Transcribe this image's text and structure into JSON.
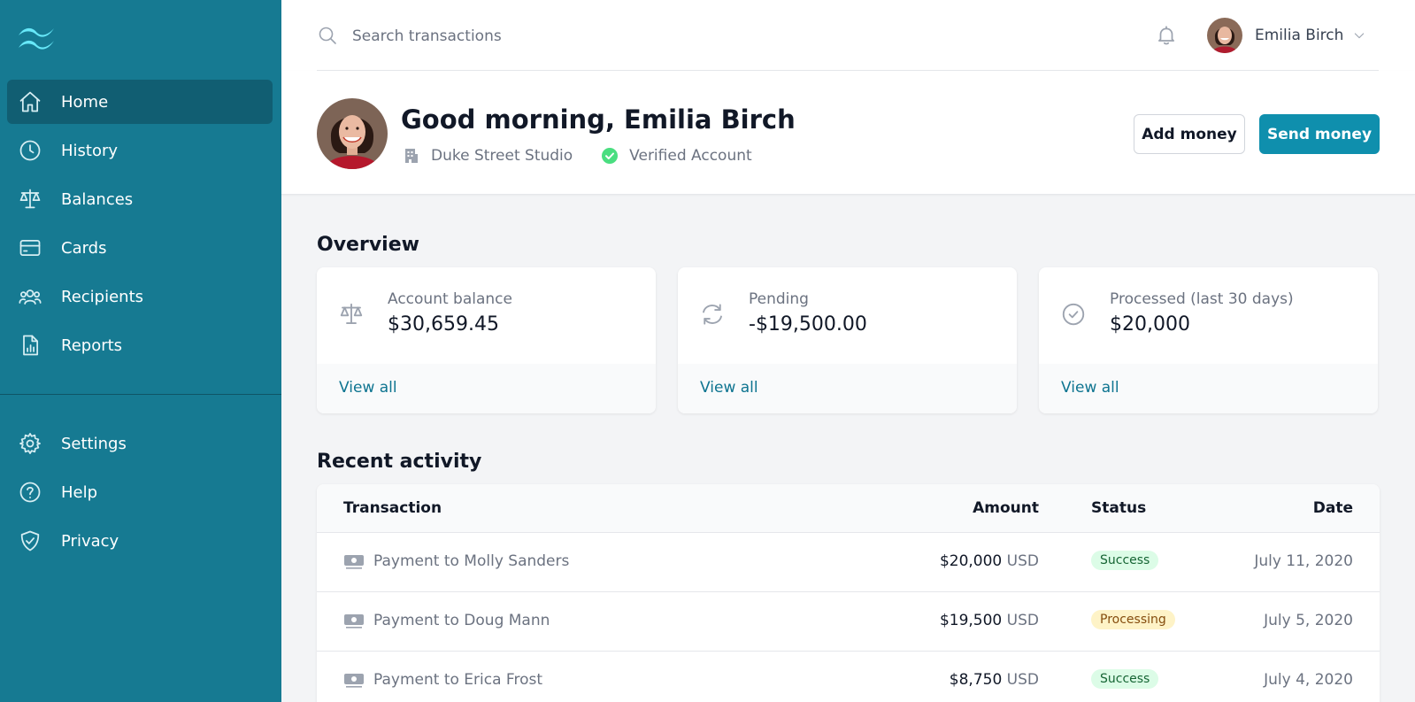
{
  "sidebar": {
    "primary": [
      {
        "label": "Home",
        "icon": "home-icon",
        "active": true
      },
      {
        "label": "History",
        "icon": "clock-icon"
      },
      {
        "label": "Balances",
        "icon": "scale-icon"
      },
      {
        "label": "Cards",
        "icon": "credit-card-icon"
      },
      {
        "label": "Recipients",
        "icon": "user-group-icon"
      },
      {
        "label": "Reports",
        "icon": "document-report-icon"
      }
    ],
    "secondary": [
      {
        "label": "Settings",
        "icon": "cog-icon"
      },
      {
        "label": "Help",
        "icon": "question-circle-icon"
      },
      {
        "label": "Privacy",
        "icon": "shield-check-icon"
      }
    ]
  },
  "topbar": {
    "search_placeholder": "Search transactions",
    "user_name": "Emilia Birch"
  },
  "header": {
    "greeting": "Good morning, Emilia Birch",
    "company": "Duke Street Studio",
    "verification": "Verified Account",
    "add_money": "Add money",
    "send_money": "Send money"
  },
  "overview": {
    "title": "Overview",
    "cards": [
      {
        "label": "Account balance",
        "value": "$30,659.45",
        "link": "View all",
        "icon": "scale-icon"
      },
      {
        "label": "Pending",
        "value": "-$19,500.00",
        "link": "View all",
        "icon": "refresh-icon"
      },
      {
        "label": "Processed (last 30 days)",
        "value": "$20,000",
        "link": "View all",
        "icon": "check-circle-icon"
      }
    ]
  },
  "activity": {
    "title": "Recent activity",
    "columns": {
      "transaction": "Transaction",
      "amount": "Amount",
      "status": "Status",
      "date": "Date"
    },
    "rows": [
      {
        "name": "Payment to Molly Sanders",
        "amount": "$20,000",
        "currency": "USD",
        "status": "Success",
        "date": "July 11, 2020"
      },
      {
        "name": "Payment to Doug Mann",
        "amount": "$19,500",
        "currency": "USD",
        "status": "Processing",
        "date": "July 5, 2020"
      },
      {
        "name": "Payment to Erica Frost",
        "amount": "$8,750",
        "currency": "USD",
        "status": "Success",
        "date": "July 4, 2020"
      }
    ]
  },
  "colors": {
    "sidebar": "#167a92",
    "sidebar_active": "#115e72",
    "primary_button": "#0f8fad",
    "link": "#0e7490",
    "success_bg": "#dcfce7",
    "processing_bg": "#fef3c7"
  }
}
